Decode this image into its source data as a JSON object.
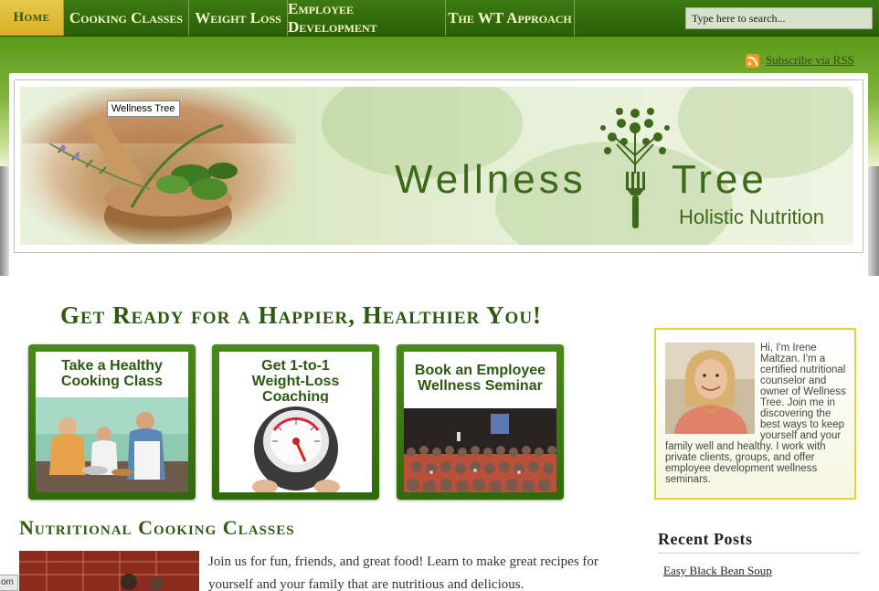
{
  "nav": {
    "items": [
      {
        "label": "Home"
      },
      {
        "label": "Cooking Classes"
      },
      {
        "label": "Weight Loss"
      },
      {
        "label": "Employee Development"
      },
      {
        "label": "The WT Approach"
      }
    ],
    "search_placeholder": "Type here to search..."
  },
  "header": {
    "rss_label": "Subscribe via RSS",
    "tooltip": "Wellness Tree",
    "brand_word_1": "Wellness",
    "brand_word_2": "Tree",
    "brand_tagline": "Holistic Nutrition"
  },
  "main": {
    "headline": "Get Ready for a Happier, Healthier You!",
    "promos": [
      {
        "title": "Take a Healthy Cooking Class"
      },
      {
        "title": "Get 1-to-1 Weight-Loss Coaching"
      },
      {
        "title": "Book an Employee Wellness Seminar"
      }
    ],
    "section_heading": "Nutritional Cooking Classes",
    "intro_text": "Join us for fun, friends, and great food! Learn to make great recipes for yourself and your family that are nutritious and delicious."
  },
  "sidebar": {
    "about_text": "Hi, I'm Irene Maltzan.  I'm a certified nutritional counselor and owner of Wellness Tree.  Join me in discovering the best ways to keep yourself and your family well and healthy.  I work with private clients, groups,  and offer employee development wellness seminars.",
    "recent_heading": "Recent Posts",
    "recent_posts": [
      "Easy Black Bean Soup"
    ]
  },
  "status_tab": "om",
  "colors": {
    "nav_green": "#2f6a0a",
    "home_gold": "#d9ae27",
    "heading_green": "#2b5a10",
    "about_border": "#e9cf3a"
  }
}
